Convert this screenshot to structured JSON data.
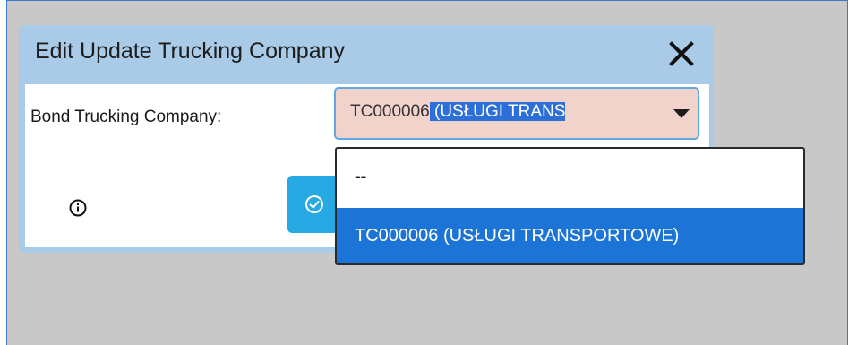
{
  "dialog": {
    "title": "Edit Update Trucking Company",
    "close_label": "close",
    "field_label": "Bond Trucking Company:",
    "select": {
      "value_code": "TC000006",
      "value_highlighted": " (USŁUGI TRANS"
    },
    "dropdown_options": [
      {
        "label": "--"
      },
      {
        "label": "TC000006 (USŁUGI TRANSPORTOWE)"
      }
    ]
  },
  "colors": {
    "header": "#a9cbe8",
    "select_bg": "#f1d3cc",
    "option_highlight": "#1c74d6",
    "confirm_button": "#27a9e3"
  },
  "icons": {
    "close": "close-icon",
    "info": "info-icon",
    "confirm": "check-circle-icon",
    "dropdown": "caret-down-icon"
  }
}
